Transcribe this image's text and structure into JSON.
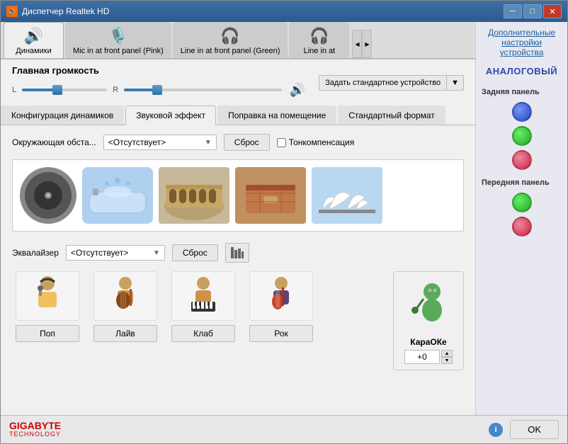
{
  "window": {
    "title": "Диспетчер Realtek HD",
    "icon": "🔊"
  },
  "device_tabs": [
    {
      "id": "dynamics",
      "label": "Динамики",
      "icon": "🔊",
      "active": true
    },
    {
      "id": "mic-front",
      "label": "Mic in at front panel (Pink)",
      "icon": "🎤",
      "active": false
    },
    {
      "id": "line-front",
      "label": "Line in at front panel (Green)",
      "icon": "🔌",
      "active": false
    },
    {
      "id": "line-in",
      "label": "Line in at",
      "icon": "🔌",
      "active": false
    }
  ],
  "volume": {
    "label": "Главная громкость",
    "left_label": "L",
    "right_label": "R",
    "value": 30,
    "icon": "🔊"
  },
  "std_device": {
    "label": "Задать стандартное устройство"
  },
  "tabs": [
    {
      "id": "config",
      "label": "Конфигурация динамиков",
      "active": false
    },
    {
      "id": "sound-effect",
      "label": "Звуковой эффект",
      "active": true
    },
    {
      "id": "room",
      "label": "Поправка на помещение",
      "active": false
    },
    {
      "id": "format",
      "label": "Стандартный формат",
      "active": false
    }
  ],
  "sound_effect": {
    "env_label": "Окружающая обста...",
    "env_value": "<Отсутствует>",
    "env_options": [
      "<Отсутствует>"
    ],
    "reset_label": "Сброс",
    "tone_label": "Тонкомпенсация",
    "presets": [
      {
        "id": "disk",
        "icon": "💿",
        "label": ""
      },
      {
        "id": "bath",
        "icon": "🛁",
        "label": ""
      },
      {
        "id": "colosseum",
        "icon": "🏟",
        "label": ""
      },
      {
        "id": "chest",
        "icon": "📦",
        "label": ""
      },
      {
        "id": "opera",
        "icon": "🎭",
        "label": ""
      }
    ],
    "eq_label": "Эквалайзер",
    "eq_value": "<Отсутствует>",
    "eq_options": [
      "<Отсутствует>"
    ],
    "eq_reset_label": "Сброс",
    "eq_presets": [
      {
        "id": "pop",
        "icon": "🎤",
        "label": "Поп"
      },
      {
        "id": "live",
        "icon": "🎸",
        "label": "Лайв"
      },
      {
        "id": "club",
        "icon": "🎹",
        "label": "Клаб"
      },
      {
        "id": "rock",
        "icon": "🎸",
        "label": "Рок"
      }
    ],
    "karaoke_label": "КараОКе",
    "karaoke_icon": "🎤",
    "karaoke_value": "+0"
  },
  "right_panel": {
    "link_label": "Дополнительные настройки устройства",
    "analog_title": "АНАЛОГОВЫЙ",
    "rear_label": "Задняя панель",
    "rear_dots": [
      {
        "color": "blue",
        "class": "dot-blue"
      },
      {
        "color": "green",
        "class": "dot-green"
      },
      {
        "color": "pink",
        "class": "dot-pink"
      }
    ],
    "front_label": "Передняя панель",
    "front_dots": [
      {
        "color": "green",
        "class": "dot-green"
      },
      {
        "color": "pink",
        "class": "dot-pink"
      }
    ]
  },
  "bottom": {
    "brand": "GIGABYTE",
    "brand_sub": "TECHNOLOGY",
    "ok_label": "OK"
  }
}
